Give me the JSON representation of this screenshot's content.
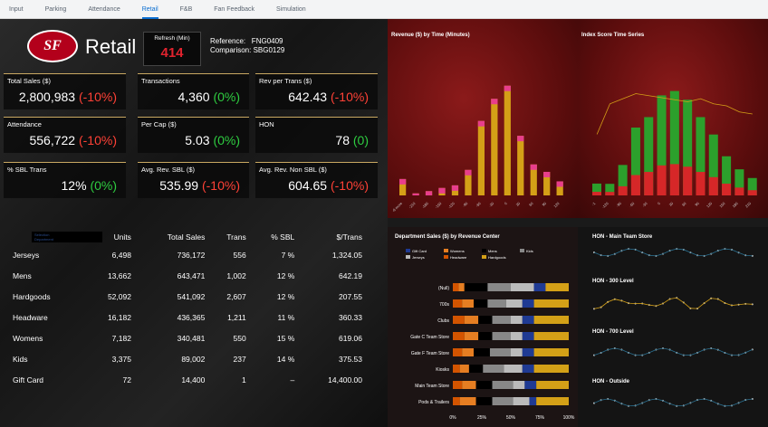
{
  "tabs": [
    "Input",
    "Parking",
    "Attendance",
    "Retail",
    "F&B",
    "Fan Feedback",
    "Simulation"
  ],
  "header": {
    "logo": "SF",
    "title": "Retail",
    "refresh_label": "Refresh (Min)",
    "refresh_value": "414",
    "reference": "Reference:   FNG0409",
    "comparison": "Comparison: SBG0129"
  },
  "kpis": [
    {
      "label": "Total Sales ($)",
      "value": "2,800,983",
      "delta": "(-10%)",
      "dir": "red"
    },
    {
      "label": "Transactions",
      "value": "4,360",
      "delta": "(0%)",
      "dir": "green"
    },
    {
      "label": "Rev per Trans ($)",
      "value": "642.43",
      "delta": "(-10%)",
      "dir": "red"
    },
    {
      "label": "Attendance",
      "value": "556,722",
      "delta": "(-10%)",
      "dir": "red"
    },
    {
      "label": "Per Cap ($)",
      "value": "5.03",
      "delta": "(0%)",
      "dir": "green"
    },
    {
      "label": "HON",
      "value": "78",
      "delta": "(0)",
      "dir": "green"
    },
    {
      "label": "% SBL Trans",
      "value": "12%",
      "delta": "(0%)",
      "dir": "green"
    },
    {
      "label": "Avg. Rev. SBL ($)",
      "value": "535.99",
      "delta": "(-10%)",
      "dir": "red"
    },
    {
      "label": "Avg. Rev. Non SBL ($)",
      "value": "604.65",
      "delta": "(-10%)",
      "dir": "red"
    }
  ],
  "selection": {
    "label": "Selection",
    "sub": "Department"
  },
  "table": {
    "headers": [
      "",
      "Units",
      "Total Sales",
      "Trans",
      "% SBL",
      "$/Trans"
    ],
    "rows": [
      [
        "Jerseys",
        "6,498",
        "736,172",
        "556",
        "7 %",
        "1,324.05"
      ],
      [
        "Mens",
        "13,662",
        "643,471",
        "1,002",
        "12 %",
        "642.19"
      ],
      [
        "Hardgoods",
        "52,092",
        "541,092",
        "2,607",
        "12 %",
        "207.55"
      ],
      [
        "Headware",
        "16,182",
        "436,365",
        "1,211",
        "11 %",
        "360.33"
      ],
      [
        "Womens",
        "7,182",
        "340,481",
        "550",
        "15 %",
        "619.06"
      ],
      [
        "Kids",
        "3,375",
        "89,002",
        "237",
        "14 %",
        "375.53"
      ],
      [
        "Gift Card",
        "72",
        "14,400",
        "1",
        "–",
        "14,400.00"
      ]
    ]
  },
  "charts": {
    "revenue_title": "Revenue ($) by Time (Minutes)",
    "index_title": "Index Score Time Series",
    "dept_title": "Department Sales ($) by Revenue Center",
    "hon_titles": [
      "HON - Main Team Store",
      "HON - 300 Level",
      "HON - 700 Level",
      "HON - Outside"
    ]
  },
  "chart_data": [
    {
      "type": "bar",
      "title": "Revenue ($) by Time (Minutes)",
      "categories": [
        "-6 more",
        "-210",
        "-180",
        "-150",
        "-120",
        "-90",
        "-60",
        "-30",
        "0",
        "30",
        "60",
        "90",
        "120"
      ],
      "series": [
        {
          "values": [
            5215,
            636,
            1353,
            2363,
            3202,
            8120,
            23700,
            30743,
            34920,
            18961,
            9856,
            7494,
            4472
          ]
        }
      ]
    },
    {
      "type": "bar",
      "title": "Index Score Time Series",
      "categories": [
        "-1",
        "-120",
        "-90",
        "-60",
        "-30",
        "0",
        "30",
        "60",
        "90",
        "120",
        "150",
        "180",
        "210"
      ],
      "series": [
        {
          "values": [
            136,
            133,
            350,
            780,
            900,
            1150,
            1200,
            1100,
            900,
            700,
            450,
            300,
            200
          ]
        }
      ]
    },
    {
      "type": "bar",
      "title": "Department Sales ($) by Revenue Center",
      "legend": [
        "Gift Card",
        "Womens",
        "Mens",
        "Kids",
        "Jerseys",
        "Headware",
        "Hardgoods"
      ],
      "categories": [
        "(Null)",
        "700s",
        "Clubs",
        "Gate C Team Store",
        "Gate F Team Store",
        "Kiosks",
        "Main Team Store",
        "Pods & Trailers"
      ],
      "xticks": [
        "0%",
        "25%",
        "50%",
        "75%",
        "100%"
      ]
    }
  ]
}
